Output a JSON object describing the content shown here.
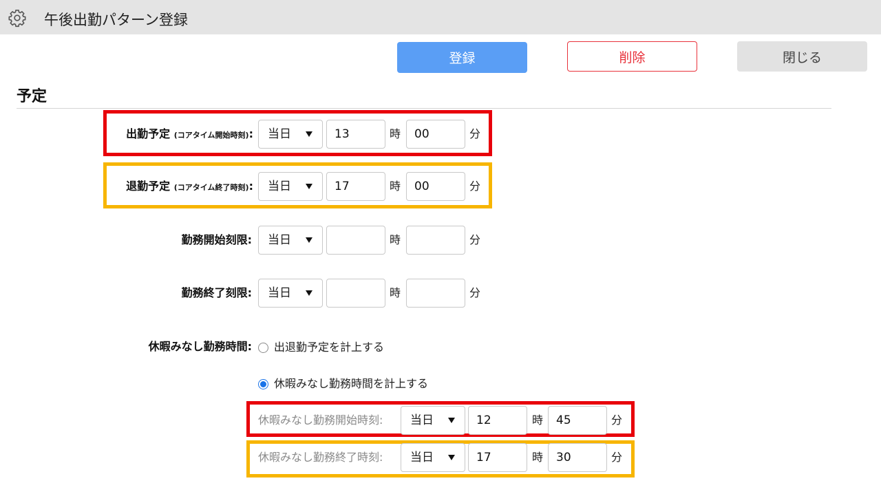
{
  "header": {
    "title": "午後出勤パターン登録",
    "icon": "gear-icon"
  },
  "toolbar": {
    "register_label": "登録",
    "delete_label": "削除",
    "close_label": "閉じる"
  },
  "section": {
    "title": "予定"
  },
  "units": {
    "hour": "時",
    "minute": "分"
  },
  "rows": [
    {
      "label": "出勤予定",
      "note": "(コアタイム開始時刻)",
      "colon": ":",
      "day": "当日",
      "hour": "13",
      "minute": "00"
    },
    {
      "label": "退勤予定",
      "note": "(コアタイム終了時刻)",
      "colon": ":",
      "day": "当日",
      "hour": "17",
      "minute": "00"
    },
    {
      "label": "勤務開始刻限:",
      "day": "当日",
      "hour": "",
      "minute": ""
    },
    {
      "label": "勤務終了刻限:",
      "day": "当日",
      "hour": "",
      "minute": ""
    }
  ],
  "leave": {
    "label": "休暇みなし勤務時間:",
    "option1": "出退勤予定を計上する",
    "option2": "休暇みなし勤務時間を計上する",
    "selected": "option2",
    "start": {
      "label": "休暇みなし勤務開始時刻:",
      "day": "当日",
      "hour": "12",
      "minute": "45"
    },
    "end": {
      "label": "休暇みなし勤務終了時刻:",
      "day": "当日",
      "hour": "17",
      "minute": "30"
    }
  },
  "colors": {
    "primary": "#5a9ef5",
    "danger": "#e8313a",
    "highlight_red": "#e8000b",
    "highlight_yellow": "#f7b500"
  }
}
